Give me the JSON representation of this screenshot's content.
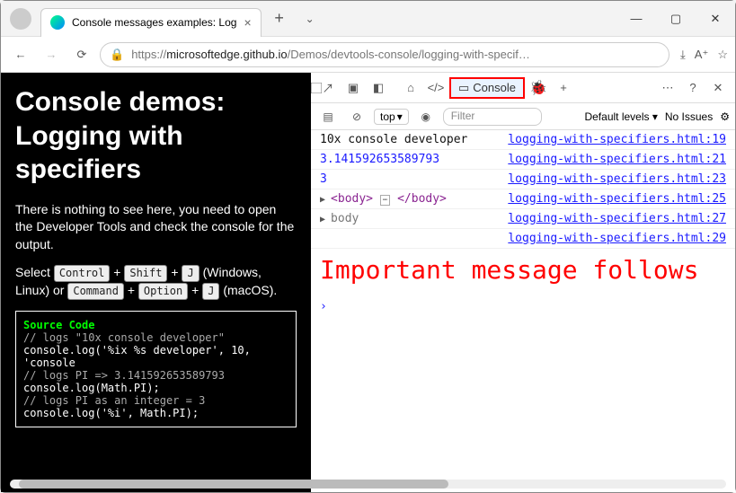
{
  "tab": {
    "title": "Console messages examples: Log"
  },
  "url": {
    "prefix": "https://",
    "dim1": "microsoftedge.github.io",
    "path": "/Demos/devtools-console/logging-with-specif…"
  },
  "page": {
    "title": "Console demos: Logging with specifiers",
    "intro": "There is nothing to see here, you need to open the Developer Tools and check the console for the output.",
    "select_pre": "Select ",
    "k_ctrl": "Control",
    "plus": " + ",
    "k_shift": "Shift",
    "k_j": "J",
    "win_lin": " (Windows, Linux) or ",
    "k_cmd": "Command",
    "k_opt": "Option",
    "mac": " (macOS).",
    "src": "Source Code",
    "c1": "// logs \"10x console developer\"",
    "c2": "console.log('%ix %s developer', 10, 'console",
    "c3": "// logs PI => 3.141592653589793",
    "c4": "console.log(Math.PI);",
    "c5": "// logs PI as an integer = 3",
    "c6": "console.log('%i', Math.PI);"
  },
  "dt": {
    "console_tab": "Console",
    "context": "top",
    "filter_ph": "Filter",
    "levels": "Default levels",
    "noissues": "No Issues",
    "rows": [
      {
        "msg": "10x console developer",
        "link": "logging-with-specifiers.html:19"
      },
      {
        "msg": "3.141592653589793",
        "link": "logging-with-specifiers.html:21"
      },
      {
        "msg": "3",
        "link": "logging-with-specifiers.html:23"
      },
      {
        "msg_html": "body_tags",
        "link": "logging-with-specifiers.html:25"
      },
      {
        "msg_html": "body_obj",
        "link": "logging-with-specifiers.html:27"
      },
      {
        "msg": "",
        "link": "logging-with-specifiers.html:29"
      }
    ],
    "big": "Important message follows"
  }
}
